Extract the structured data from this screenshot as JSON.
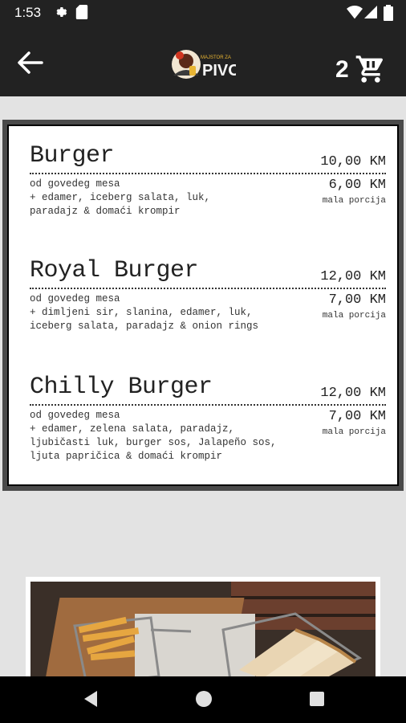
{
  "status": {
    "time": "1:53"
  },
  "appbar": {
    "cart_count": "2"
  },
  "menu": {
    "items": [
      {
        "name": "Burger",
        "price": "10,00 KM",
        "desc": [
          "od govedeg mesa",
          "+ edamer, iceberg salata, luk,",
          "paradajz & domaći krompir"
        ],
        "small_price": "6,00 KM",
        "small_label": "mala porcija"
      },
      {
        "name": "Royal Burger",
        "price": "12,00 KM",
        "desc": [
          "od govedeg mesa",
          "+ dimljeni sir, slanina, edamer, luk,",
          "iceberg salata, paradajz & onion rings"
        ],
        "small_price": "7,00 KM",
        "small_label": "mala porcija"
      },
      {
        "name": "Chilly Burger",
        "price": "12,00 KM",
        "desc": [
          "od govedeg mesa",
          "+ edamer, zelena salata, paradajz,",
          "ljubičasti luk, burger sos, Jalapeño sos,",
          "ljuta papričica & domaći krompir"
        ],
        "small_price": "7,00 KM",
        "small_label": "mala porcija"
      }
    ]
  },
  "colors": {
    "bar": "#222222",
    "background": "#e3e3e3"
  },
  "icons": [
    "settings-icon",
    "sd-card-icon",
    "wifi-icon",
    "signal-icon",
    "battery-icon",
    "back-arrow-icon",
    "cart-icon",
    "nav-back-icon",
    "nav-home-icon",
    "nav-recents-icon"
  ]
}
